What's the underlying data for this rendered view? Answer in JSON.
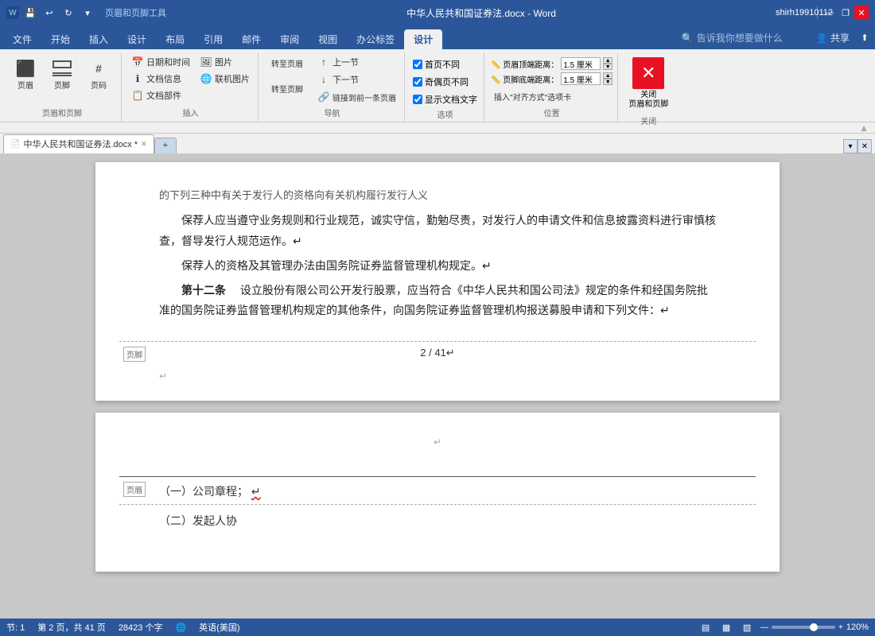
{
  "titlebar": {
    "title": "中华人民共和国证券法.docx - Word",
    "tool_title": "页眉和页脚工具",
    "user": "shirh19910112",
    "save_icon": "💾",
    "undo_icon": "↩",
    "redo_icon": "↻",
    "customize_icon": "▼",
    "minimize": "—",
    "restore": "❐",
    "close": "✕"
  },
  "ribbon_tabs": [
    {
      "label": "文件",
      "active": false
    },
    {
      "label": "开始",
      "active": false
    },
    {
      "label": "插入",
      "active": false
    },
    {
      "label": "设计",
      "active": false
    },
    {
      "label": "布局",
      "active": false
    },
    {
      "label": "引用",
      "active": false
    },
    {
      "label": "邮件",
      "active": false
    },
    {
      "label": "审阅",
      "active": false
    },
    {
      "label": "视图",
      "active": false
    },
    {
      "label": "办公标签",
      "active": false
    },
    {
      "label": "设计",
      "active": true
    },
    {
      "label": "🔍 告诉我你想要做什么",
      "active": false,
      "special": true
    }
  ],
  "ribbon_groups": {
    "navigation": {
      "label": "导航",
      "buttons": [
        {
          "label": "上一节",
          "icon": "⬆"
        },
        {
          "label": "下一节",
          "icon": "⬇"
        },
        {
          "label": "链接到前一条页眉",
          "icon": "🔗"
        }
      ]
    },
    "header_footer": {
      "label": "页眉和页脚",
      "header_btn": "页眉",
      "footer_btn": "页脚",
      "pagenumber_btn": "页码"
    },
    "insert": {
      "label": "插入",
      "buttons": [
        "日期和时间",
        "文档信息",
        "文档部件",
        "图片",
        "联机图片",
        "转至页眉",
        "转至页脚"
      ]
    },
    "options": {
      "label": "选项",
      "checkboxes": [
        {
          "label": "首页不同",
          "checked": true
        },
        {
          "label": "奇偶页不同",
          "checked": true
        },
        {
          "label": "显示文档文字",
          "checked": true
        }
      ]
    },
    "position": {
      "label": "位置",
      "rows": [
        {
          "label": "页眉顶端距离：",
          "value": "1.5",
          "unit": "厘米"
        },
        {
          "label": "页脚底端距离：",
          "value": "1.5",
          "unit": "厘米"
        },
        {
          "button": "插入\"对齐方式\"选项卡"
        }
      ]
    },
    "close": {
      "label": "关闭",
      "button": "关闭页眉和页脚"
    }
  },
  "doc_tab": {
    "icon": "📄",
    "label": "中华人民共和国证券法.docx",
    "modified": true,
    "blank_tab": "+"
  },
  "document": {
    "page2": {
      "top_text": "的下列三种中有关于发行人的资格向有关机构履行发行人义",
      "para1": "保荐人应当遵守业务规则和行业规范，诚实守信，勤勉尽责，对发行人的申请文件和信息披露资料进行审慎核查，督导发行人规范运作。",
      "para2": "保荐人的资格及其管理办法由国务院证券监督管理机构规定。",
      "article": "第十二条",
      "article_text": "设立股份有限公司公开发行股票，应当符合《中华人民共和国公司法》规定的条件和经国务院批准的国务院证券监督管理机构规定的其他条件，向国务院证券监督管理机构报送募股申请和下列文件：",
      "footer_label": "页脚",
      "footer_text": "2 / 41",
      "return_mark": "↵"
    },
    "page3": {
      "header_label": "页眉",
      "header_item1": "（一）公司章程；",
      "header_item2": "（二）发起人协"
    }
  },
  "statusbar": {
    "section": "节: 1",
    "page": "第 2 页，共 41 页",
    "words": "28423 个字",
    "lang_icon": "🌐",
    "language": "英语(美国)",
    "view_icons": [
      "▤",
      "▦",
      "▧"
    ],
    "zoom": "120%",
    "zoom_value": 120
  }
}
